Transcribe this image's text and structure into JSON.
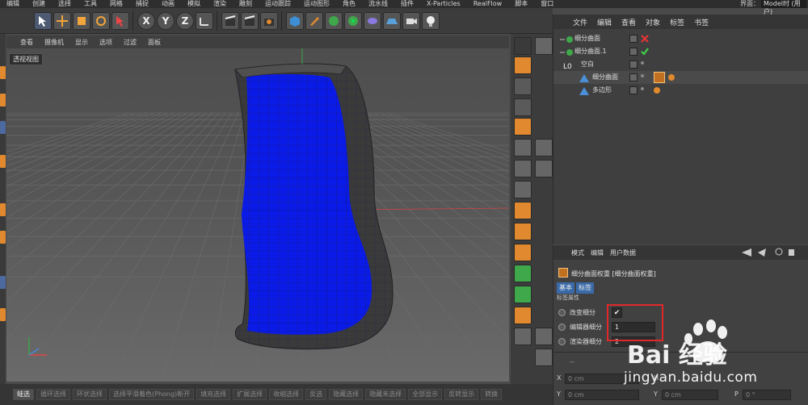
{
  "menubar": {
    "items": [
      "编辑",
      "创建",
      "选择",
      "工具",
      "网格",
      "捕捉",
      "动画",
      "模拟",
      "渲染",
      "雕刻",
      "运动跟踪",
      "运动图形",
      "角色",
      "流水线",
      "插件",
      "X-Particles",
      "RealFlow",
      "脚本",
      "窗口"
    ],
    "layout_label": "界面：",
    "layout_value": "Model时 (用户)"
  },
  "toolbar": {
    "axis_x": "X",
    "axis_y": "Y",
    "axis_z": "Z"
  },
  "viewport": {
    "menu": [
      "查看",
      "摄像机",
      "显示",
      "选项",
      "过滤",
      "面板"
    ],
    "label": "透视视图"
  },
  "bottom_bar": {
    "buttons": [
      "蛙选",
      "循环选择",
      "环状选择",
      "选择平滑着色(Phong)断开",
      "填充选择",
      "扩展选择",
      "收缩选择",
      "反选",
      "隐藏选择",
      "隐藏未选择",
      "全部显示",
      "反转显示",
      "转换"
    ]
  },
  "object_manager": {
    "menu": [
      "文件",
      "编辑",
      "查看",
      "对象",
      "标签",
      "书签"
    ],
    "objects": [
      {
        "name": "细分曲面"
      },
      {
        "name": "细分曲面.1"
      },
      {
        "name": "空白"
      },
      {
        "name": "细分曲面"
      },
      {
        "name": "多边形"
      }
    ]
  },
  "attribute_manager": {
    "menu": [
      "模式",
      "编辑",
      "用户数据"
    ],
    "title": "细分曲面权重 [细分曲面权重]",
    "tabs": [
      "基本",
      "标签"
    ],
    "section": "标签属性",
    "rows": [
      {
        "label": "改变细分",
        "value": "✔"
      },
      {
        "label": "编辑器细分",
        "value": "1"
      },
      {
        "label": "渲染器细分",
        "value": "2"
      }
    ],
    "coords": {
      "divider": "--",
      "x_label": "X",
      "x_value": "0 cm",
      "y_label": "Y",
      "y_value": "0 cm",
      "y2_label": "Y",
      "y2_value": "0 cm",
      "h_label": "H",
      "p_label": "P",
      "p_value": "0 °"
    }
  },
  "watermark": {
    "brand": "Bai 经验",
    "url": "jingyan.baidu.com"
  },
  "colors": {
    "object_blue": "#0a1be8",
    "accent_orange": "#e0892e",
    "highlight_red": "#e0282b"
  }
}
